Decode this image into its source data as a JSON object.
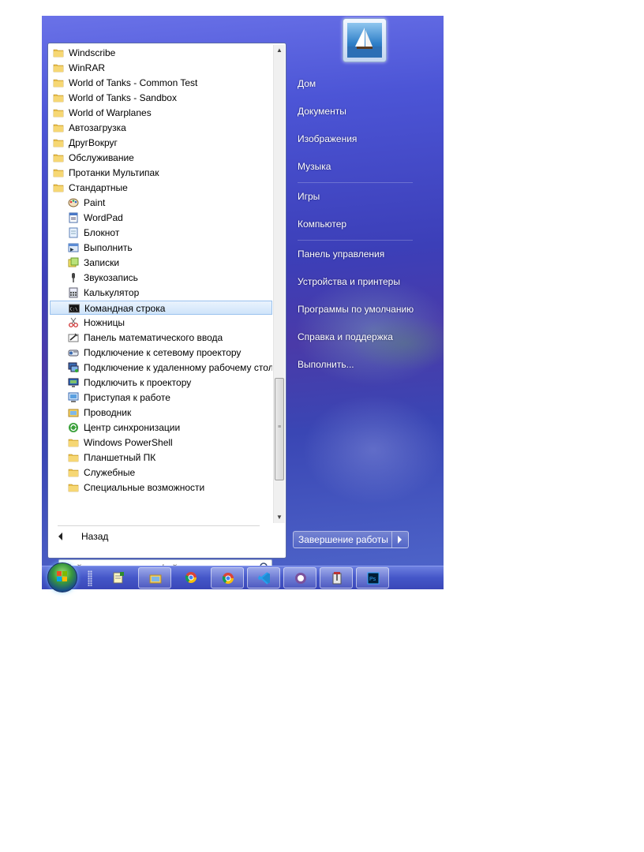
{
  "program_list": [
    {
      "label": "Windscribe",
      "icon": "folder-icon",
      "level": 0
    },
    {
      "label": "WinRAR",
      "icon": "folder-icon",
      "level": 0
    },
    {
      "label": "World of Tanks - Common Test",
      "icon": "folder-icon",
      "level": 0
    },
    {
      "label": "World of Tanks - Sandbox",
      "icon": "folder-icon",
      "level": 0
    },
    {
      "label": "World of Warplanes",
      "icon": "folder-icon",
      "level": 0
    },
    {
      "label": "Автозагрузка",
      "icon": "folder-icon",
      "level": 0
    },
    {
      "label": "ДругВокруг",
      "icon": "folder-icon",
      "level": 0
    },
    {
      "label": "Обслуживание",
      "icon": "folder-icon",
      "level": 0
    },
    {
      "label": "Протанки Мультипак",
      "icon": "folder-icon",
      "level": 0
    },
    {
      "label": "Стандартные",
      "icon": "folder-icon",
      "level": 0
    },
    {
      "label": "Paint",
      "icon": "paint-palette-icon",
      "level": 1
    },
    {
      "label": "WordPad",
      "icon": "wordpad-icon",
      "level": 1
    },
    {
      "label": "Блокнот",
      "icon": "notepad-icon",
      "level": 1
    },
    {
      "label": "Выполнить",
      "icon": "run-icon",
      "level": 1
    },
    {
      "label": "Записки",
      "icon": "sticky-notes-icon",
      "level": 1
    },
    {
      "label": "Звукозапись",
      "icon": "microphone-icon",
      "level": 1
    },
    {
      "label": "Калькулятор",
      "icon": "calculator-icon",
      "level": 1
    },
    {
      "label": "Командная строка",
      "icon": "command-prompt-icon",
      "level": 1,
      "selected": true
    },
    {
      "label": "Ножницы",
      "icon": "scissors-icon",
      "level": 1
    },
    {
      "label": "Панель математического ввода",
      "icon": "math-input-icon",
      "level": 1
    },
    {
      "label": "Подключение к сетевому проектору",
      "icon": "network-projector-icon",
      "level": 1
    },
    {
      "label": "Подключение к удаленному рабочему столу",
      "icon": "remote-desktop-icon",
      "level": 1
    },
    {
      "label": "Подключить к проектору",
      "icon": "projector-icon",
      "level": 1
    },
    {
      "label": "Приступая к работе",
      "icon": "getting-started-icon",
      "level": 1
    },
    {
      "label": "Проводник",
      "icon": "explorer-icon",
      "level": 1
    },
    {
      "label": "Центр синхронизации",
      "icon": "sync-center-icon",
      "level": 1
    },
    {
      "label": "Windows PowerShell",
      "icon": "folder-icon",
      "level": 1
    },
    {
      "label": "Планшетный ПК",
      "icon": "folder-icon",
      "level": 1
    },
    {
      "label": "Служебные",
      "icon": "folder-icon",
      "level": 1
    },
    {
      "label": "Специальные возможности",
      "icon": "folder-icon",
      "level": 1
    }
  ],
  "back_label": "Назад",
  "search": {
    "placeholder": "Найти программы и файлы"
  },
  "right_links": {
    "home": "Дом",
    "documents": "Документы",
    "pictures": "Изображения",
    "music": "Музыка",
    "games": "Игры",
    "computer": "Компьютер",
    "control_panel": "Панель управления",
    "devices_printers": "Устройства и принтеры",
    "default_programs": "Программы по умолчанию",
    "help_support": "Справка и поддержка",
    "run": "Выполнить..."
  },
  "shutdown_label": "Завершение работы",
  "taskbar_items": [
    "notepad-icon",
    "explorer-icon",
    "chrome-icon",
    "chrome-canary-icon",
    "vscode-icon",
    "viber-icon",
    "archive-icon",
    "photoshop-icon"
  ],
  "colors": {
    "selection": "#cfe4fa",
    "menu_blue": "#4c55d6",
    "taskbar": "#4456c8"
  }
}
